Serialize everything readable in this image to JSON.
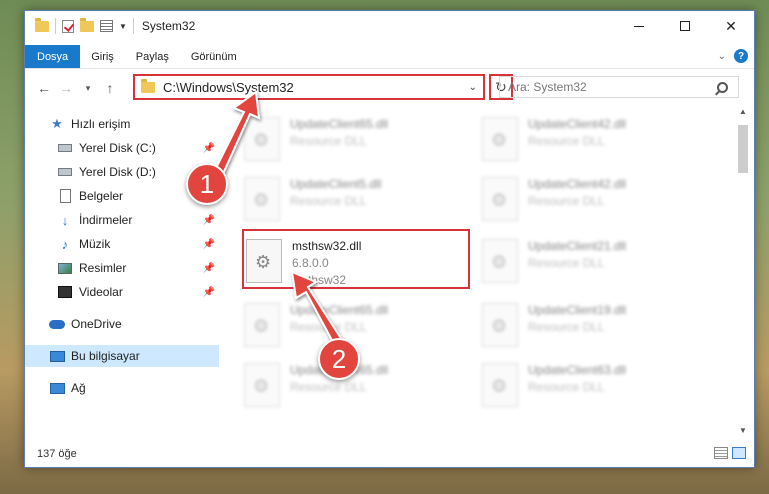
{
  "window": {
    "title": "System32"
  },
  "ribbon": {
    "tabs": [
      "Dosya",
      "Giriş",
      "Paylaş",
      "Görünüm"
    ]
  },
  "address": {
    "path": "C:\\Windows\\System32",
    "search_placeholder": "Ara: System32"
  },
  "nav": {
    "items": [
      {
        "label": "Hızlı erişim",
        "icon": "star-icon"
      },
      {
        "label": "Yerel Disk (C:)",
        "icon": "drive-icon",
        "pinned": true
      },
      {
        "label": "Yerel Disk (D:)",
        "icon": "drive-icon",
        "pinned": false
      },
      {
        "label": "Belgeler",
        "icon": "documents-icon",
        "pinned": false
      },
      {
        "label": "İndirmeler",
        "icon": "download-icon",
        "pinned": true
      },
      {
        "label": "Müzik",
        "icon": "music-icon",
        "pinned": true
      },
      {
        "label": "Resimler",
        "icon": "pictures-icon",
        "pinned": true
      },
      {
        "label": "Videolar",
        "icon": "videos-icon",
        "pinned": true
      },
      {
        "label": "OneDrive",
        "icon": "cloud-icon"
      },
      {
        "label": "Bu bilgisayar",
        "icon": "computer-icon",
        "selected": true
      },
      {
        "label": "Ağ",
        "icon": "network-icon"
      }
    ]
  },
  "files": [
    {
      "name": "UpdateClient65.dll",
      "sub": "Resource DLL"
    },
    {
      "name": "UpdateClient42.dll",
      "sub": "Resource DLL"
    },
    {
      "name": "UpdateClient5.dll",
      "sub": "Resource DLL"
    },
    {
      "name": "UpdateClient42.dll",
      "sub": "Resource DLL"
    },
    {
      "name": "msthsw32.dll",
      "version": "6.8.0.0",
      "sub": "msthsw32",
      "highlighted": true
    },
    {
      "name": "UpdateClient21.dll",
      "sub": "Resource DLL"
    },
    {
      "name": "UpdateClient65.dll",
      "sub": "Resource DLL"
    },
    {
      "name": "UpdateClient19.dll",
      "sub": "Resource DLL"
    },
    {
      "name": "UpdateClient65.dll",
      "sub": "Resource DLL"
    },
    {
      "name": "UpdateClient63.dll",
      "sub": "Resource DLL"
    }
  ],
  "status": {
    "count": "137 öğe"
  },
  "annotations": {
    "step1": "1",
    "step2": "2",
    "color": "#e2453e"
  }
}
